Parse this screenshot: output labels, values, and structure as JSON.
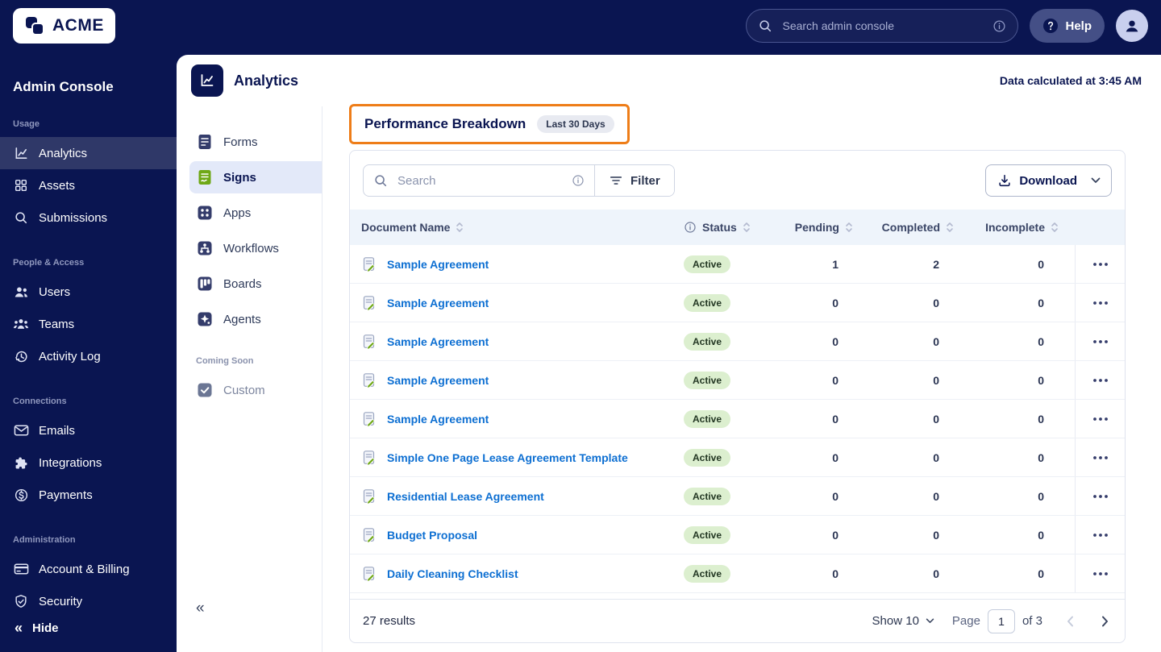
{
  "topbar": {
    "logo_text": "ACME",
    "search_placeholder": "Search admin console",
    "help_label": "Help"
  },
  "sidebar": {
    "title": "Admin Console",
    "hide_label": "Hide",
    "sections": [
      {
        "label": "Usage",
        "items": [
          {
            "label": "Analytics",
            "icon": "analytics",
            "active": true
          },
          {
            "label": "Assets",
            "icon": "assets",
            "active": false
          },
          {
            "label": "Submissions",
            "icon": "submissions",
            "active": false
          }
        ]
      },
      {
        "label": "People & Access",
        "items": [
          {
            "label": "Users",
            "icon": "users",
            "active": false
          },
          {
            "label": "Teams",
            "icon": "teams",
            "active": false
          },
          {
            "label": "Activity Log",
            "icon": "activity-log",
            "active": false
          }
        ]
      },
      {
        "label": "Connections",
        "items": [
          {
            "label": "Emails",
            "icon": "emails",
            "active": false
          },
          {
            "label": "Integrations",
            "icon": "integrations",
            "active": false
          },
          {
            "label": "Payments",
            "icon": "payments",
            "active": false
          }
        ]
      },
      {
        "label": "Administration",
        "items": [
          {
            "label": "Account & Billing",
            "icon": "account-billing",
            "active": false
          },
          {
            "label": "Security",
            "icon": "security",
            "active": false
          }
        ]
      }
    ]
  },
  "app_header": {
    "title": "Analytics",
    "data_note": "Data calculated at 3:45 AM"
  },
  "subnav": {
    "items": [
      {
        "label": "Forms",
        "icon": "forms",
        "active": false
      },
      {
        "label": "Signs",
        "icon": "signs",
        "active": true
      },
      {
        "label": "Apps",
        "icon": "apps",
        "active": false
      },
      {
        "label": "Workflows",
        "icon": "workflows",
        "active": false
      },
      {
        "label": "Boards",
        "icon": "boards",
        "active": false
      },
      {
        "label": "Agents",
        "icon": "agents",
        "active": false
      }
    ],
    "coming_soon_label": "Coming Soon",
    "coming_soon_items": [
      {
        "label": "Custom",
        "icon": "custom"
      }
    ]
  },
  "content": {
    "heading": "Performance Breakdown",
    "period_badge": "Last 30 Days",
    "toolbar": {
      "search_placeholder": "Search",
      "filter_label": "Filter",
      "download_label": "Download"
    },
    "table": {
      "columns": [
        {
          "label": "Document Name",
          "align": "left",
          "sortable": true,
          "info": false
        },
        {
          "label": "Status",
          "align": "left",
          "sortable": true,
          "info": true
        },
        {
          "label": "Pending",
          "align": "right",
          "sortable": true,
          "info": false
        },
        {
          "label": "Completed",
          "align": "right",
          "sortable": true,
          "info": false
        },
        {
          "label": "Incomplete",
          "align": "right",
          "sortable": true,
          "info": false
        }
      ],
      "rows": [
        {
          "name": "Sample Agreement",
          "status": "Active",
          "pending": "1",
          "completed": "2",
          "incomplete": "0"
        },
        {
          "name": "Sample Agreement",
          "status": "Active",
          "pending": "0",
          "completed": "0",
          "incomplete": "0"
        },
        {
          "name": "Sample Agreement",
          "status": "Active",
          "pending": "0",
          "completed": "0",
          "incomplete": "0"
        },
        {
          "name": "Sample Agreement",
          "status": "Active",
          "pending": "0",
          "completed": "0",
          "incomplete": "0"
        },
        {
          "name": "Sample Agreement",
          "status": "Active",
          "pending": "0",
          "completed": "0",
          "incomplete": "0"
        },
        {
          "name": "Simple One Page Lease Agreement Template",
          "status": "Active",
          "pending": "0",
          "completed": "0",
          "incomplete": "0"
        },
        {
          "name": "Residential Lease Agreement",
          "status": "Active",
          "pending": "0",
          "completed": "0",
          "incomplete": "0"
        },
        {
          "name": "Budget Proposal",
          "status": "Active",
          "pending": "0",
          "completed": "0",
          "incomplete": "0"
        },
        {
          "name": "Daily Cleaning Checklist",
          "status": "Active",
          "pending": "0",
          "completed": "0",
          "incomplete": "0"
        }
      ]
    },
    "footer": {
      "results": "27 results",
      "show_label": "Show 10",
      "page_label": "Page",
      "page_value": "1",
      "of_label": "of 3"
    }
  },
  "colors": {
    "navy": "#0a1551",
    "accent_orange": "#ee7d18",
    "link_blue": "#0d6fd2",
    "active_badge_bg": "#dcefcf",
    "active_badge_text": "#233723",
    "sign_green": "#6fa816",
    "table_header_bg": "#eef4fb"
  }
}
